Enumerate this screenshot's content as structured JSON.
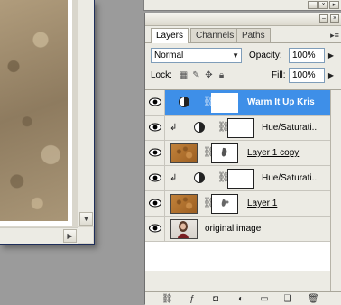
{
  "document": {
    "hscroll_arrow": "▶",
    "vscroll_arrow": "▼"
  },
  "palette": {
    "tabs": [
      {
        "label": "Layers",
        "active": true
      },
      {
        "label": "Channels",
        "active": false
      },
      {
        "label": "Paths",
        "active": false
      }
    ],
    "menu_icon": "▸≡",
    "blend_mode": "Normal",
    "opacity_label": "Opacity:",
    "opacity_value": "100%",
    "lock_label": "Lock:",
    "fill_label": "Fill:",
    "fill_value": "100%",
    "layers": [
      {
        "name": "Warm It Up Kris",
        "selected": true,
        "type": "adjustment"
      },
      {
        "name": "Hue/Saturati...",
        "selected": false,
        "type": "adjustment-clipped"
      },
      {
        "name": "Layer 1 copy",
        "selected": false,
        "type": "texture"
      },
      {
        "name": "Hue/Saturati...",
        "selected": false,
        "type": "adjustment-clipped"
      },
      {
        "name": "Layer 1",
        "selected": false,
        "type": "texture"
      },
      {
        "name": "original image",
        "selected": false,
        "type": "photo"
      }
    ],
    "bottom_icons": [
      "link-layers-icon",
      "layer-style-icon",
      "add-mask-icon",
      "new-adjustment-icon",
      "new-group-icon",
      "new-layer-icon",
      "trash-icon"
    ]
  },
  "colors": {
    "selection": "#3e8fe8",
    "panel": "#ecebe4",
    "workspace": "#9b9b9b"
  }
}
